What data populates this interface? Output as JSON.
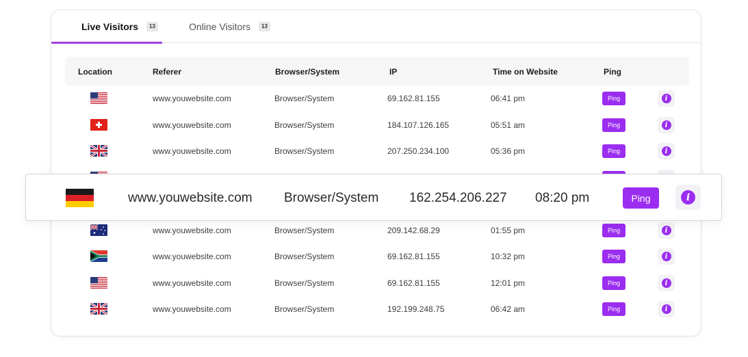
{
  "tabs": [
    {
      "label": "Live Visitors",
      "count": "13"
    },
    {
      "label": "Online Visitors",
      "count": "13"
    }
  ],
  "columns": [
    "Location",
    "Referer",
    "Browser/System",
    "IP",
    "Time on Website",
    "Ping"
  ],
  "ping_label": "Ping",
  "info_glyph": "i",
  "rows": [
    {
      "flag": "us",
      "referer": "www.youwebsite.com",
      "browser": "Browser/System",
      "ip": "69.162.81.155",
      "time": "06:41 pm"
    },
    {
      "flag": "ch",
      "referer": "www.youwebsite.com",
      "browser": "Browser/System",
      "ip": "184.107.126.165",
      "time": "05:51 am"
    },
    {
      "flag": "uk",
      "referer": "www.youwebsite.com",
      "browser": "Browser/System",
      "ip": "207.250.234.100",
      "time": "05:36 pm"
    },
    {
      "flag": "au",
      "referer": "www.youwebsite.com",
      "browser": "Browser/System",
      "ip": "209.142.68.29",
      "time": "01:55 pm"
    },
    {
      "flag": "za",
      "referer": "www.youwebsite.com",
      "browser": "Browser/System",
      "ip": "69.162.81.155",
      "time": "10:32 pm"
    },
    {
      "flag": "us",
      "referer": "www.youwebsite.com",
      "browser": "Browser/System",
      "ip": "69.162.81.155",
      "time": "12:01 pm"
    },
    {
      "flag": "uk",
      "referer": "www.youwebsite.com",
      "browser": "Browser/System",
      "ip": "192.199.248.75",
      "time": "06:42 am"
    }
  ],
  "highlighted_row": {
    "flag": "de",
    "referer": "www.youwebsite.com",
    "browser": "Browser/System",
    "ip": "162.254.206.227",
    "time": "08:20 pm"
  },
  "colors": {
    "accent": "#9b2df0"
  }
}
